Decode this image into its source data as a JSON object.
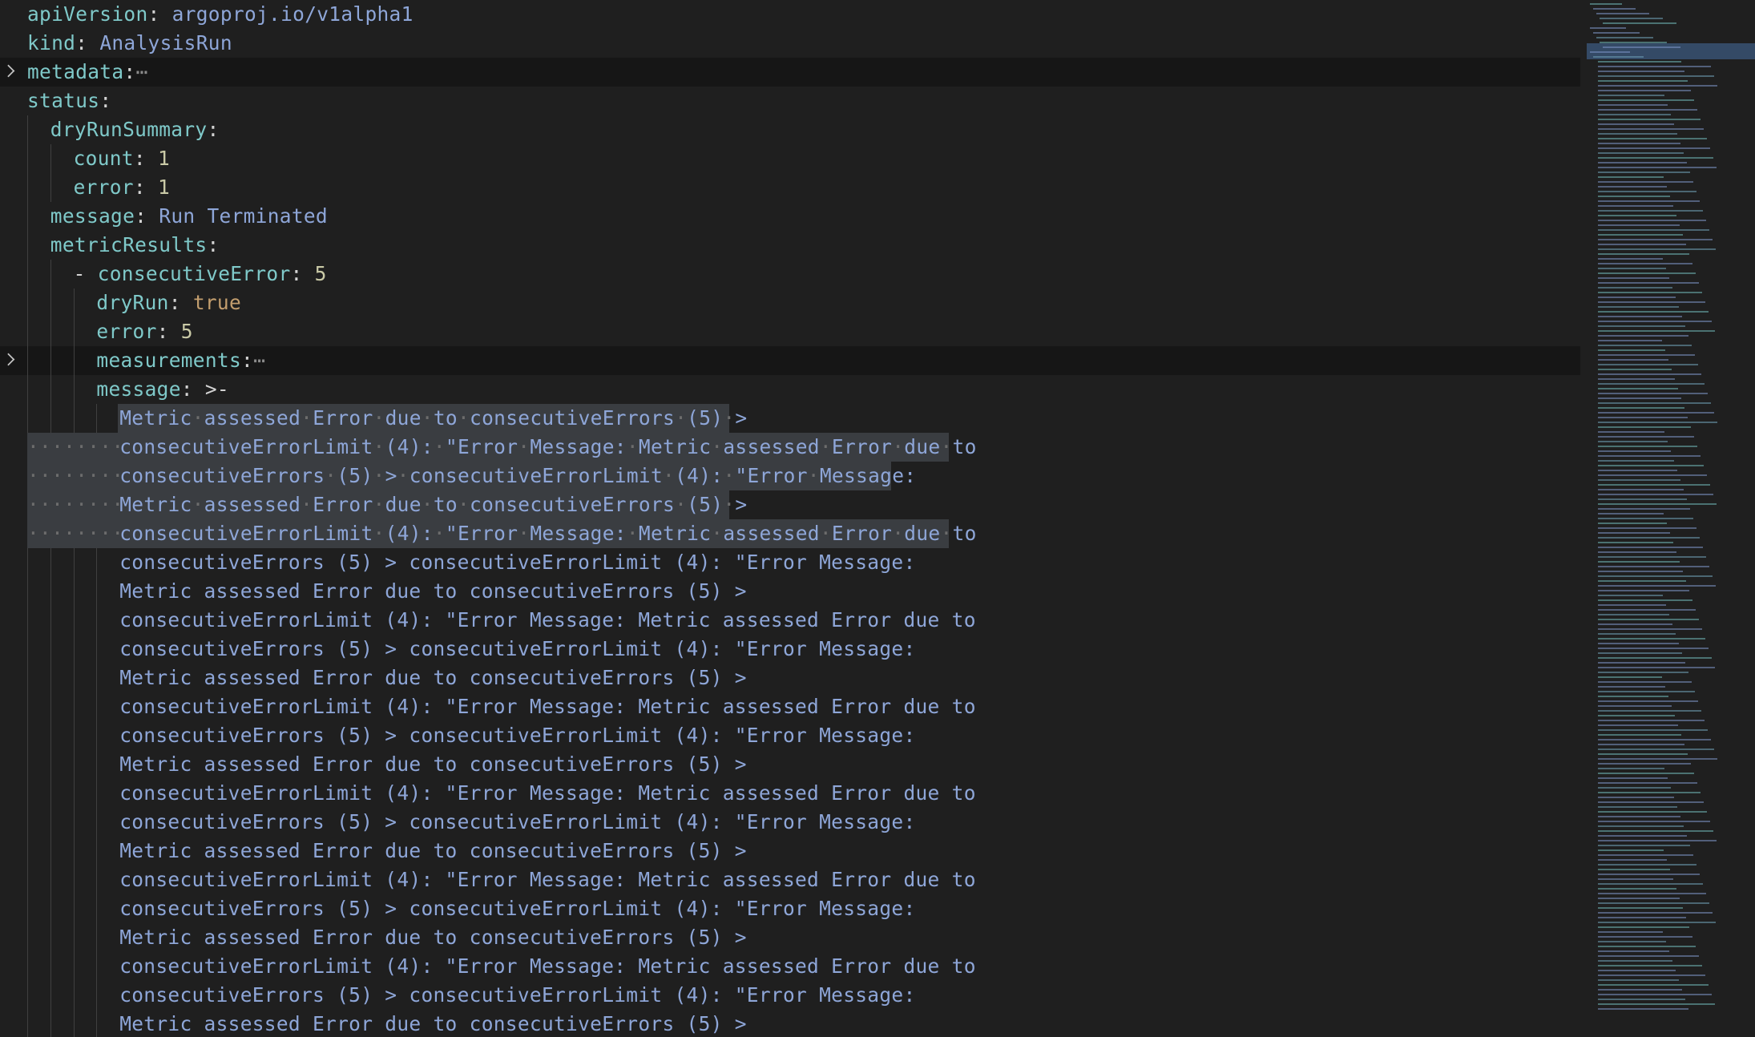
{
  "editor": {
    "language": "yaml",
    "lines": [
      {
        "key": "apiVersion",
        "value": "argoproj.io/v1alpha1",
        "vtype": "string"
      },
      {
        "key": "kind",
        "value": "AnalysisRun",
        "vtype": "string"
      },
      {
        "key": "metadata",
        "folded": true,
        "ellipsis": "⋯"
      },
      {
        "key": "status"
      },
      {
        "key": "dryRunSummary"
      },
      {
        "key": "count",
        "value": "1",
        "vtype": "number"
      },
      {
        "key": "error",
        "value": "1",
        "vtype": "number"
      },
      {
        "key": "message",
        "value": "Run Terminated",
        "vtype": "string"
      },
      {
        "key": "metricResults"
      },
      {
        "dash": "- ",
        "key": "consecutiveError",
        "value": "5",
        "vtype": "number"
      },
      {
        "key": "dryRun",
        "value": "true",
        "vtype": "bool"
      },
      {
        "key": "error",
        "value": "5",
        "vtype": "number"
      },
      {
        "key": "measurements",
        "folded": true,
        "ellipsis": "⋯"
      },
      {
        "key": "message",
        "value": ">-",
        "vtype": "plain"
      }
    ],
    "message_block": [
      "Metric assessed Error due to consecutiveErrors (5) >",
      "consecutiveErrorLimit (4): \"Error Message: Metric assessed Error due to",
      "consecutiveErrors (5) > consecutiveErrorLimit (4): \"Error Message:",
      "Metric assessed Error due to consecutiveErrors (5) >",
      "consecutiveErrorLimit (4): \"Error Message: Metric assessed Error due to",
      "consecutiveErrors (5) > consecutiveErrorLimit (4): \"Error Message:",
      "Metric assessed Error due to consecutiveErrors (5) >",
      "consecutiveErrorLimit (4): \"Error Message: Metric assessed Error due to",
      "consecutiveErrors (5) > consecutiveErrorLimit (4): \"Error Message:",
      "Metric assessed Error due to consecutiveErrors (5) >",
      "consecutiveErrorLimit (4): \"Error Message: Metric assessed Error due to",
      "consecutiveErrors (5) > consecutiveErrorLimit (4): \"Error Message:",
      "Metric assessed Error due to consecutiveErrors (5) >",
      "consecutiveErrorLimit (4): \"Error Message: Metric assessed Error due to",
      "consecutiveErrors (5) > consecutiveErrorLimit (4): \"Error Message:",
      "Metric assessed Error due to consecutiveErrors (5) >",
      "consecutiveErrorLimit (4): \"Error Message: Metric assessed Error due to",
      "consecutiveErrors (5) > consecutiveErrorLimit (4): \"Error Message:",
      "Metric assessed Error due to consecutiveErrors (5) >",
      "consecutiveErrorLimit (4): \"Error Message: Metric assessed Error due to",
      "consecutiveErrors (5) > consecutiveErrorLimit (4): \"Error Message:",
      "Metric assessed Error due to consecutiveErrors (5) >"
    ],
    "selected_block_lines": 5
  },
  "colors": {
    "background": "#1f1f1f",
    "key": "#7fc9c9",
    "string": "#8ea6d8",
    "boolean": "#c39e6e",
    "number": "#c9c9a6",
    "selection": "#3a3d41",
    "folded_line": "#161616",
    "minimap_slider": "#466ea0"
  },
  "icons": {
    "fold": "chevron-right-icon"
  }
}
